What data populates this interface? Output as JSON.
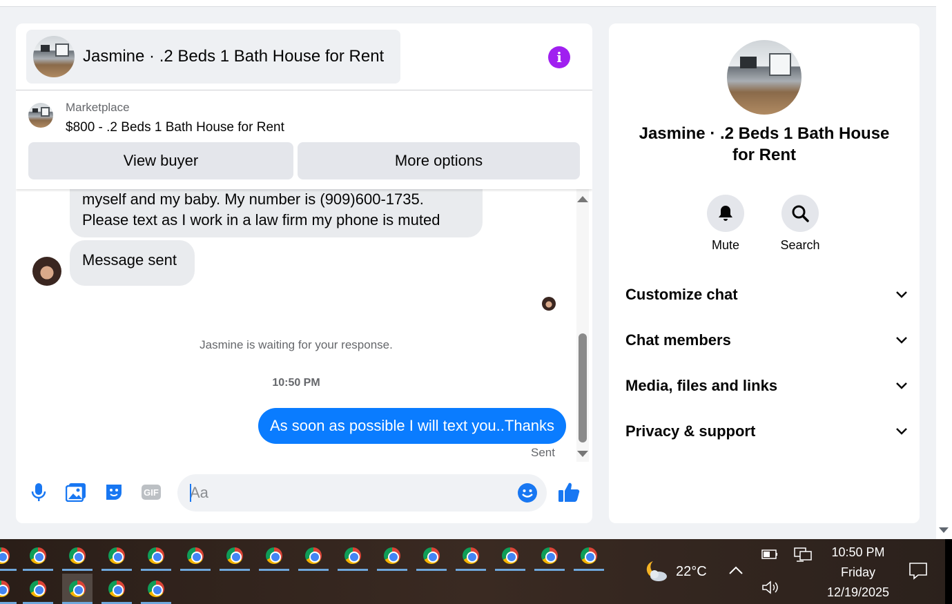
{
  "conversation": {
    "title": "Jasmine · .2 Beds 1 Bath House for Rent"
  },
  "marketplace": {
    "label": "Marketplace",
    "listing": "$800 - .2 Beds 1 Bath House for Rent",
    "view_buyer": "View buyer",
    "more_options": "More options"
  },
  "messages": {
    "incoming_1_line1": "myself and my baby. My number is (909)600-1735.",
    "incoming_1_line2": "Please text as I work in a law firm my phone is muted",
    "incoming_2": "Message sent",
    "waiting": "Jasmine is waiting for your response.",
    "timestamp": "10:50 PM",
    "outgoing_1": "As soon as possible I will text you..Thanks",
    "outgoing_status": "Sent"
  },
  "composer": {
    "placeholder": "Aa",
    "gif_label": "GIF"
  },
  "info_panel": {
    "title": "Jasmine · .2 Beds 1 Bath House for Rent",
    "mute": "Mute",
    "search": "Search",
    "sections": [
      "Customize chat",
      "Chat members",
      "Media, files and links",
      "Privacy & support"
    ]
  },
  "taskbar": {
    "temperature": "22°C",
    "time": "10:50 PM",
    "day": "Friday",
    "date": "12/19/2025"
  },
  "colors": {
    "messenger_blue": "#0a7cff",
    "info_purple": "#a020f0",
    "icon_blue": "#1877f2"
  }
}
